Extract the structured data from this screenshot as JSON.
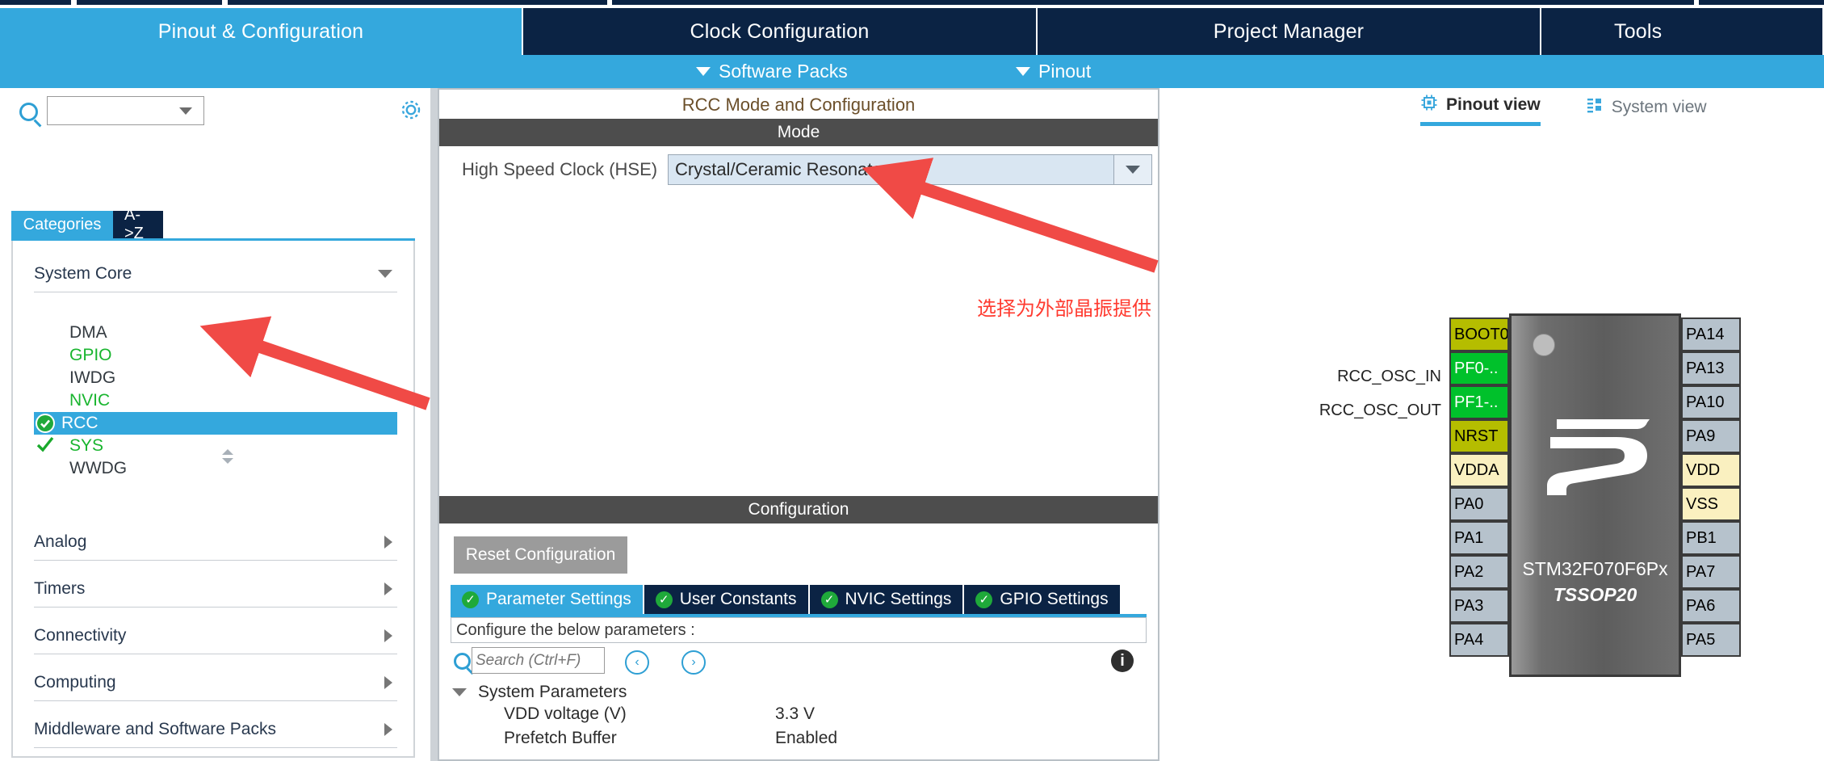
{
  "app": {
    "main_tabs": [
      {
        "label": "Pinout & Configuration",
        "active": true
      },
      {
        "label": "Clock Configuration",
        "active": false
      },
      {
        "label": "Project Manager",
        "active": false
      },
      {
        "label": "Tools",
        "active": false
      }
    ],
    "menu_strip": [
      {
        "label": "Software Packs",
        "icon": "chevron-down-icon"
      },
      {
        "label": "Pinout",
        "icon": "chevron-down-icon"
      }
    ]
  },
  "sidebar": {
    "search": {
      "value": "",
      "placeholder": "",
      "icon": "search-icon"
    },
    "gear_icon": "gear-icon",
    "view_tabs": [
      {
        "label": "Categories",
        "active": true
      },
      {
        "label": "A->Z",
        "active": false
      }
    ],
    "groups": [
      {
        "label": "System Core",
        "expanded": true,
        "items": [
          {
            "label": "DMA",
            "state": "plain",
            "selected": false
          },
          {
            "label": "GPIO",
            "state": "green",
            "selected": false
          },
          {
            "label": "IWDG",
            "state": "plain",
            "selected": false
          },
          {
            "label": "NVIC",
            "state": "green",
            "selected": false
          },
          {
            "label": "RCC",
            "state": "badge",
            "selected": true
          },
          {
            "label": "SYS",
            "state": "tick",
            "selected": false
          },
          {
            "label": "WWDG",
            "state": "plain",
            "selected": false
          }
        ]
      },
      {
        "label": "Analog",
        "expanded": false,
        "items": []
      },
      {
        "label": "Timers",
        "expanded": false,
        "items": []
      },
      {
        "label": "Connectivity",
        "expanded": false,
        "items": []
      },
      {
        "label": "Computing",
        "expanded": false,
        "items": []
      },
      {
        "label": "Middleware and Software Packs",
        "expanded": false,
        "items": []
      }
    ]
  },
  "center": {
    "panel_title": "RCC Mode and Configuration",
    "mode": {
      "header": "Mode",
      "hse_label": "High Speed Clock (HSE)",
      "hse_value": "Crystal/Ceramic Resonator"
    },
    "configuration": {
      "header": "Configuration",
      "reset_button": "Reset Configuration",
      "tabs": [
        {
          "label": "Parameter Settings",
          "active": true
        },
        {
          "label": "User Constants",
          "active": false
        },
        {
          "label": "NVIC Settings",
          "active": false
        },
        {
          "label": "GPIO Settings",
          "active": false
        }
      ],
      "note": "Configure the below parameters :",
      "search_placeholder": "Search (Ctrl+F)",
      "search_value": "",
      "nav_prev_icon": "chevron-left-circle-icon",
      "nav_next_icon": "chevron-right-circle-icon",
      "info_icon": "info-icon",
      "groups": [
        {
          "label": "System Parameters",
          "expanded": true,
          "rows": [
            {
              "name": "VDD voltage (V)",
              "value": "3.3 V"
            },
            {
              "name": "Prefetch Buffer",
              "value": "Enabled"
            }
          ]
        }
      ]
    }
  },
  "right": {
    "view_tabs": [
      {
        "label": "Pinout view",
        "active": true,
        "icon": "chip-icon"
      },
      {
        "label": "System view",
        "active": false,
        "icon": "list-icon"
      }
    ],
    "chip": {
      "part_number": "STM32F070F6Px",
      "package": "TSSOP20",
      "left_pins": [
        {
          "label": "BOOT0",
          "color": "#b5bd00"
        },
        {
          "label": "PF0-..",
          "color": "#00c12b"
        },
        {
          "label": "PF1-..",
          "color": "#00c12b"
        },
        {
          "label": "NRST",
          "color": "#b5bd00"
        },
        {
          "label": "VDDA",
          "color": "#faf0c0"
        },
        {
          "label": "PA0",
          "color": "#b6c2cc"
        },
        {
          "label": "PA1",
          "color": "#b6c2cc"
        },
        {
          "label": "PA2",
          "color": "#b6c2cc"
        },
        {
          "label": "PA3",
          "color": "#b6c2cc"
        },
        {
          "label": "PA4",
          "color": "#b6c2cc"
        }
      ],
      "right_pins": [
        {
          "label": "PA14",
          "color": "#b6c2cc"
        },
        {
          "label": "PA13",
          "color": "#b6c2cc"
        },
        {
          "label": "PA10",
          "color": "#b6c2cc"
        },
        {
          "label": "PA9",
          "color": "#b6c2cc"
        },
        {
          "label": "VDD",
          "color": "#faf0c0"
        },
        {
          "label": "VSS",
          "color": "#faf0c0"
        },
        {
          "label": "PB1",
          "color": "#b6c2cc"
        },
        {
          "label": "PA7",
          "color": "#b6c2cc"
        },
        {
          "label": "PA6",
          "color": "#b6c2cc"
        },
        {
          "label": "PA5",
          "color": "#b6c2cc"
        }
      ],
      "signal_labels": [
        {
          "text": "RCC_OSC_IN",
          "pin_index": 1
        },
        {
          "text": "RCC_OSC_OUT",
          "pin_index": 2
        }
      ]
    }
  },
  "annotation": {
    "text": "选择为外部晶振提供",
    "color": "#ff3b30"
  },
  "colors": {
    "accent_blue": "#34a8dd",
    "dark_navy": "#0b2344",
    "header_gray": "#4d4d4d",
    "green": "#19b52f"
  }
}
